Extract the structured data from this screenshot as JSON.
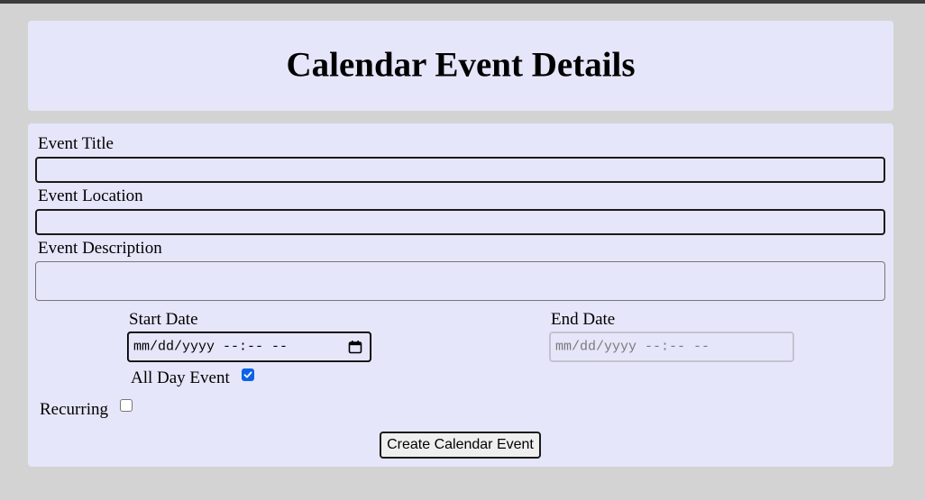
{
  "header": {
    "title": "Calendar Event Details"
  },
  "form": {
    "event_title": {
      "label": "Event Title",
      "value": ""
    },
    "event_location": {
      "label": "Event Location",
      "value": ""
    },
    "event_description": {
      "label": "Event Description",
      "value": ""
    },
    "start_date": {
      "label": "Start Date",
      "placeholder": "mm/dd/yyyy --:-- --"
    },
    "end_date": {
      "label": "End Date",
      "placeholder": "mm/dd/yyyy --:-- --",
      "disabled": true
    },
    "all_day": {
      "label": "All Day Event",
      "checked": true
    },
    "recurring": {
      "label": "Recurring",
      "checked": false
    },
    "submit_label": "Create Calendar Event"
  },
  "colors": {
    "page_background": "#d3d3d3",
    "panel_background": "#e6e6fa",
    "checkbox_accent": "#0b63e5"
  }
}
